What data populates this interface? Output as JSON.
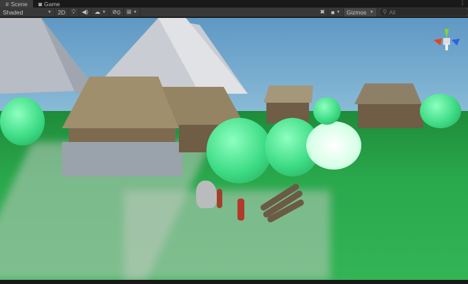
{
  "tabs": [
    {
      "label": "Scene",
      "icon": "grid-icon",
      "active": true
    },
    {
      "label": "Game",
      "icon": "gamepad-icon",
      "active": false
    }
  ],
  "toolbar": {
    "shading_mode": "Shaded",
    "mode_2d": "2D",
    "effects_count": "0",
    "gizmos_label": "Gizmos",
    "search_placeholder": "All"
  },
  "colors": {
    "toolbar": "#383838",
    "tabbar": "#191919",
    "gizmo_x": "#e8421f",
    "gizmo_y": "#8bd12b",
    "gizmo_z": "#2b62e6"
  }
}
